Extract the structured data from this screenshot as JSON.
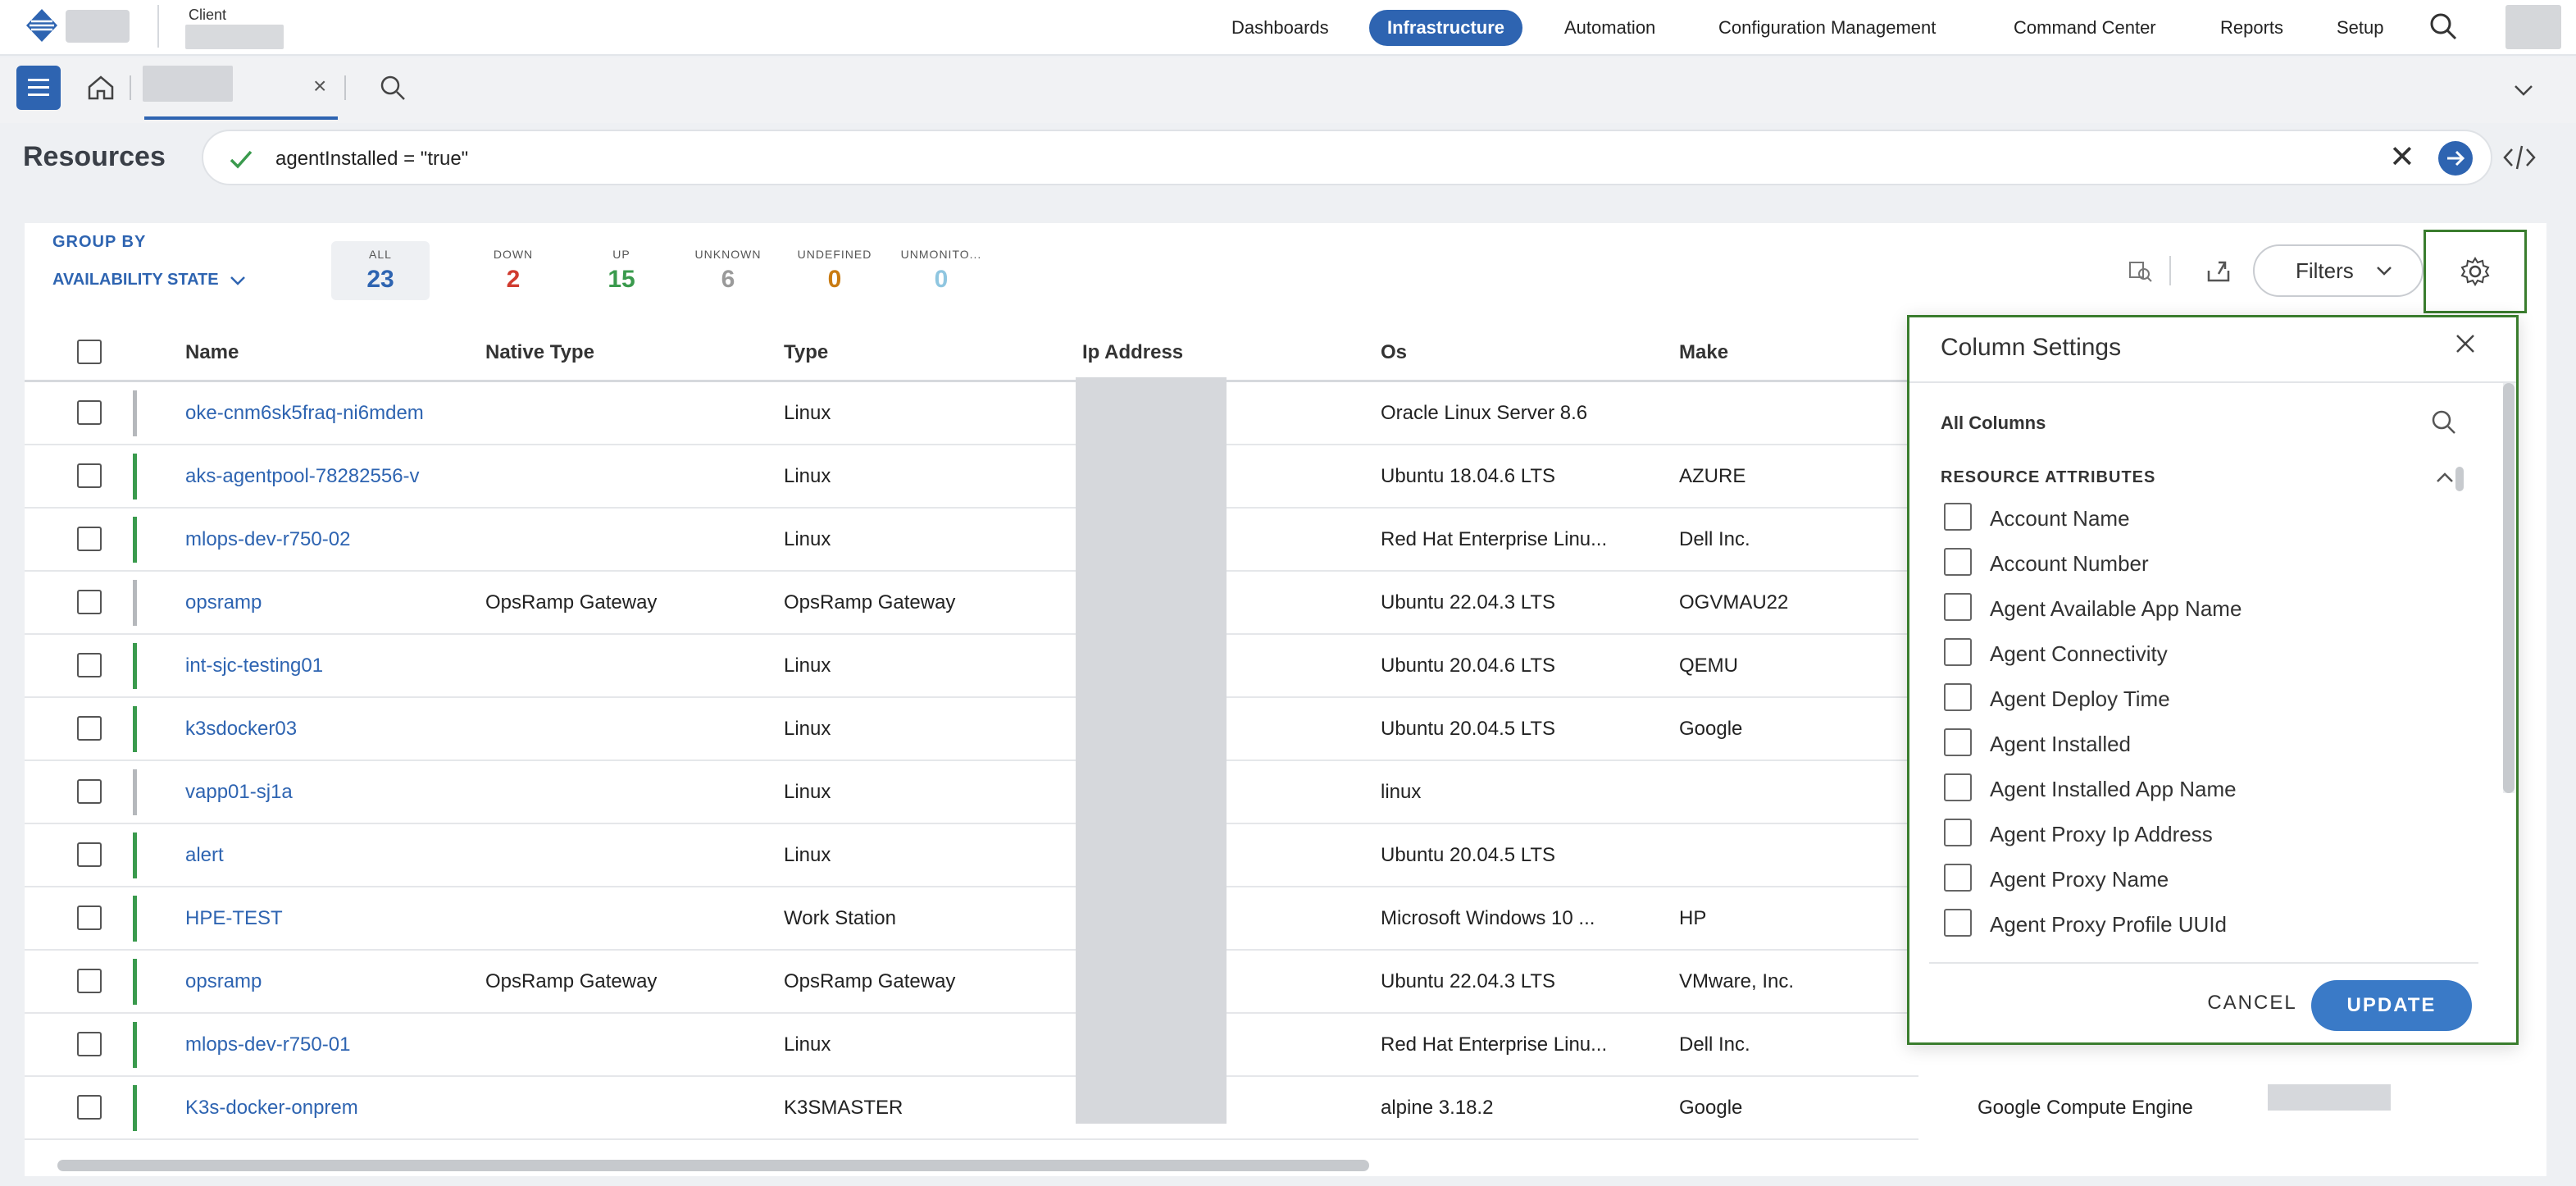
{
  "topnav": {
    "client_label": "Client",
    "items": [
      "Dashboards",
      "Infrastructure",
      "Automation",
      "Configuration Management",
      "Command Center",
      "Reports",
      "Setup"
    ],
    "active_item": "Infrastructure",
    "accent_color": "#2e64b1"
  },
  "subbar": {
    "tab_close": "×"
  },
  "resources": {
    "title": "Resources",
    "query": "agentInstalled = \"true\"",
    "clear": "✕"
  },
  "panel": {
    "group_by_label": "GROUP BY",
    "group_by_value": "AVAILABILITY STATE",
    "counters": [
      {
        "label": "ALL",
        "value": "23",
        "color": "#2e64b1"
      },
      {
        "label": "DOWN",
        "value": "2",
        "color": "#d03b2f"
      },
      {
        "label": "UP",
        "value": "15",
        "color": "#3a9a4d"
      },
      {
        "label": "UNKNOWN",
        "value": "6",
        "color": "#9a9a9a"
      },
      {
        "label": "UNDEFINED",
        "value": "0",
        "color": "#c97b12"
      },
      {
        "label": "UNMONITO...",
        "value": "0",
        "color": "#8fc6e0"
      }
    ],
    "filters_label": "Filters"
  },
  "table": {
    "headers": [
      "Name",
      "Native Type",
      "Type",
      "Ip Address",
      "Os",
      "Make"
    ],
    "rows": [
      {
        "name": "oke-cnm6sk5fraq-ni6mdem",
        "native": "",
        "type": "Linux",
        "os": "Oracle Linux Server 8.6",
        "make": "",
        "status": "unknown"
      },
      {
        "name": "aks-agentpool-78282556-v",
        "native": "",
        "type": "Linux",
        "os": "Ubuntu 18.04.6 LTS",
        "make": "AZURE",
        "status": "up"
      },
      {
        "name": "mlops-dev-r750-02",
        "native": "",
        "type": "Linux",
        "os": "Red Hat Enterprise Linu...",
        "make": "Dell Inc.",
        "status": "up"
      },
      {
        "name": "opsramp",
        "native": "OpsRamp Gateway",
        "type": "OpsRamp Gateway",
        "os": "Ubuntu 22.04.3 LTS",
        "make": "OGVMAU22",
        "status": "unknown"
      },
      {
        "name": "int-sjc-testing01",
        "native": "",
        "type": "Linux",
        "os": "Ubuntu 20.04.6 LTS",
        "make": "QEMU",
        "status": "up"
      },
      {
        "name": "k3sdocker03",
        "native": "",
        "type": "Linux",
        "os": "Ubuntu 20.04.5 LTS",
        "make": "Google",
        "status": "up"
      },
      {
        "name": "vapp01-sj1a",
        "native": "",
        "type": "Linux",
        "os": "linux",
        "make": "",
        "status": "unknown"
      },
      {
        "name": "alert",
        "native": "",
        "type": "Linux",
        "os": "Ubuntu 20.04.5 LTS",
        "make": "",
        "status": "up"
      },
      {
        "name": "HPE-TEST",
        "native": "",
        "type": "Work Station",
        "os": "Microsoft Windows 10 ...",
        "make": "HP",
        "status": "up"
      },
      {
        "name": "opsramp",
        "native": "OpsRamp Gateway",
        "type": "OpsRamp Gateway",
        "os": "Ubuntu 22.04.3 LTS",
        "make": "VMware, Inc.",
        "status": "up"
      },
      {
        "name": "mlops-dev-r750-01",
        "native": "",
        "type": "Linux",
        "os": "Red Hat Enterprise Linu...",
        "make": "Dell Inc.",
        "status": "up"
      },
      {
        "name": "K3s-docker-onprem",
        "native": "",
        "type": "K3SMASTER",
        "os": "alpine 3.18.2",
        "make": "Google",
        "status": "up"
      }
    ],
    "last_row_extra": "Google Compute Engine",
    "status_colors": {
      "up": "#3a9a4d",
      "unknown": "#b5b8bc"
    }
  },
  "popup": {
    "title": "Column Settings",
    "all_columns": "All Columns",
    "section": "RESOURCE ATTRIBUTES",
    "options": [
      "Account Name",
      "Account Number",
      "Agent Available App Name",
      "Agent Connectivity",
      "Agent Deploy Time",
      "Agent Installed",
      "Agent Installed App Name",
      "Agent Proxy Ip Address",
      "Agent Proxy Name",
      "Agent Proxy Profile UUId"
    ],
    "cancel": "CANCEL",
    "update": "UPDATE"
  }
}
